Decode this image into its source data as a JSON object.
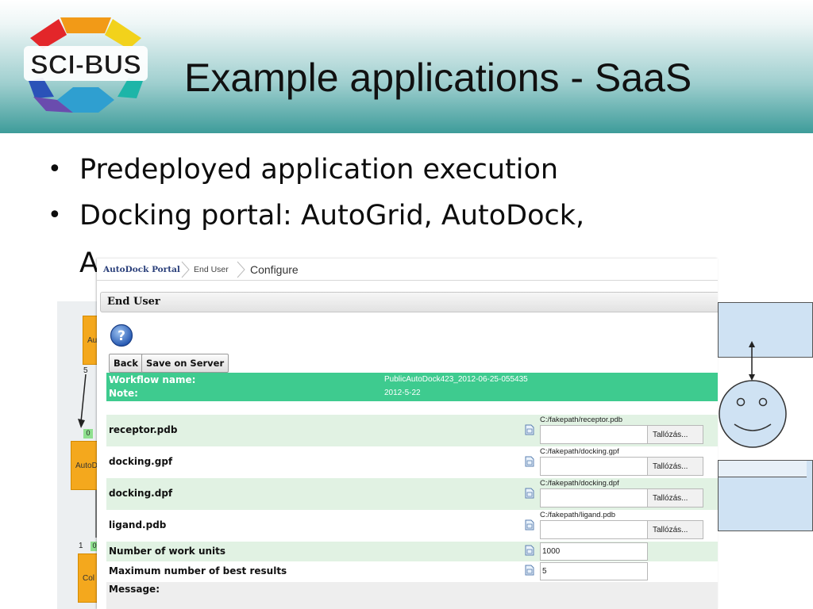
{
  "slide": {
    "title": "Example applications - SaaS",
    "logo_text": "SCI-BUS",
    "bullets": [
      "Predeployed application execution",
      "Docking portal: AutoGrid, AutoDock,"
    ],
    "bullet_continuation": "AutoDockVina (should be deployed)",
    "bullet_continuation_visible": "A"
  },
  "diagram": {
    "nodes": [
      "Au",
      "AutoD",
      "Col"
    ],
    "port_numbers": [
      "5",
      "1"
    ],
    "green_ports": [
      "0",
      "0"
    ]
  },
  "portal": {
    "breadcrumb": [
      "AutoDock Portal",
      "End User",
      "Configure"
    ],
    "section_title": "End User",
    "buttons": {
      "back": "Back",
      "save": "Save on Server"
    },
    "workflow": {
      "name_label": "Workflow name:",
      "name_value": "PublicAutoDock423_2012-06-25-055435",
      "note_label": "Note:",
      "note_value": "2012-5-22"
    },
    "file_params": [
      {
        "label": "receptor.pdb",
        "path": "C:/fakepath/receptor.pdb",
        "browse": "Tallózás..."
      },
      {
        "label": "docking.gpf",
        "path": "C:/fakepath/docking.gpf",
        "browse": "Tallózás..."
      },
      {
        "label": "docking.dpf",
        "path": "C:/fakepath/docking.dpf",
        "browse": "Tallózás..."
      },
      {
        "label": "ligand.pdb",
        "path": "C:/fakepath/ligand.pdb",
        "browse": "Tallózás..."
      }
    ],
    "work_units": {
      "label": "Number of work units",
      "value": "1000"
    },
    "best_results": {
      "label": "Maximum number of best results",
      "value": "5"
    },
    "message_label": "Message:"
  },
  "colors": {
    "header_teal": "#3e9c9a",
    "workflow_green": "#3ecb8f",
    "row_alt": "#e1f2e3",
    "node_orange": "#f4a81d",
    "box_blue": "#cfe2f3"
  }
}
